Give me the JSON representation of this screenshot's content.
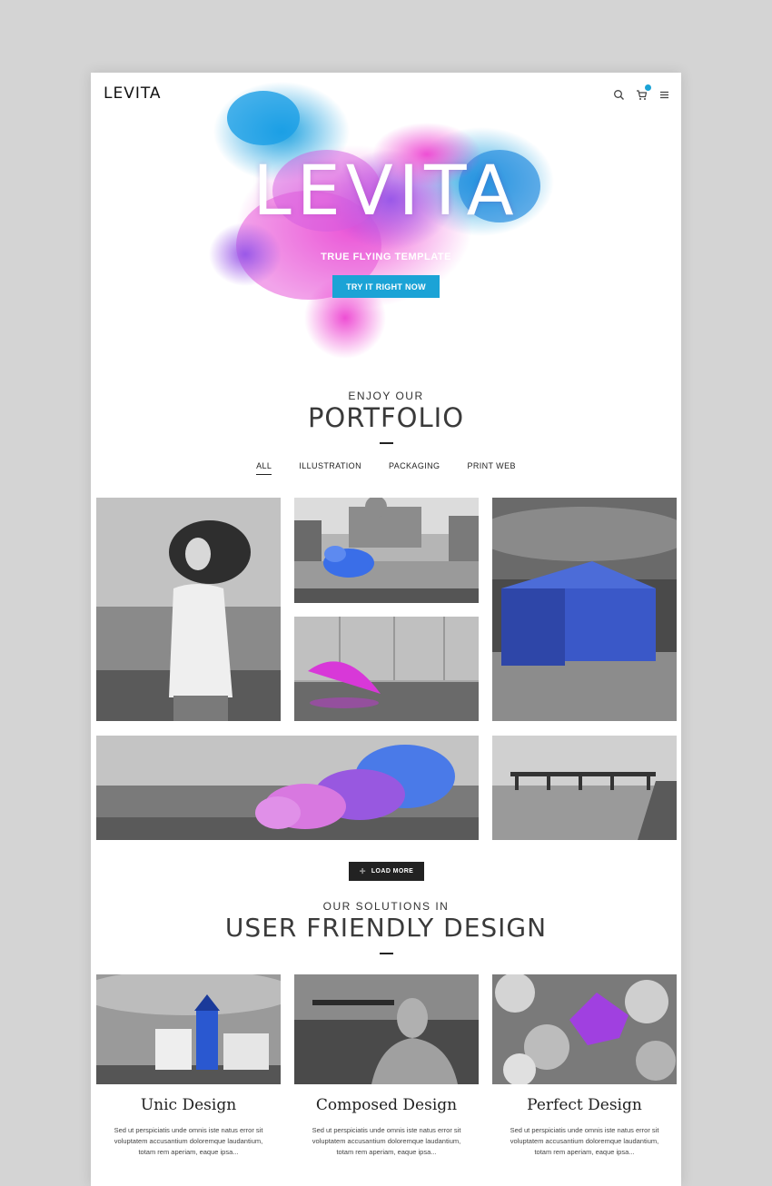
{
  "header": {
    "logo": "LEVITA",
    "icons": [
      "search-icon",
      "cart-icon",
      "menu-icon"
    ],
    "accent_color": "#1ba3d6"
  },
  "hero": {
    "title": "LEVITA",
    "subtitle": "TRUE FLYING TEMPLATE",
    "cta_label": "TRY IT RIGHT NOW",
    "splash_colors": [
      "#1ba3d6",
      "#e84fd8",
      "#b050e0"
    ]
  },
  "portfolio": {
    "kicker": "ENJOY OUR",
    "title": "PORTFOLIO",
    "filters": [
      "ALL",
      "ILLUSTRATION",
      "PACKAGING",
      "PRINT WEB"
    ],
    "active_filter": "ALL",
    "load_more_label": "LOAD MORE"
  },
  "solutions": {
    "kicker": "OUR SOLUTIONS IN",
    "title": "USER FRIENDLY DESIGN",
    "cards": [
      {
        "title": "Unic Design",
        "line1": "Sed ut perspiciatis unde omnis iste natus error sit",
        "line2": "voluptatem accusantium doloremque laudantium,",
        "line3": "totam rem aperiam, eaque ipsa..."
      },
      {
        "title": "Composed Design",
        "line1": "Sed ut perspiciatis unde omnis iste natus error sit",
        "line2": "voluptatem accusantium doloremque laudantium,",
        "line3": "totam rem aperiam, eaque ipsa..."
      },
      {
        "title": "Perfect Design",
        "line1": "Sed ut perspiciatis unde omnis iste natus error sit",
        "line2": "voluptatem accusantium doloremque laudantium,",
        "line3": "totam rem aperiam, eaque ipsa..."
      }
    ]
  }
}
